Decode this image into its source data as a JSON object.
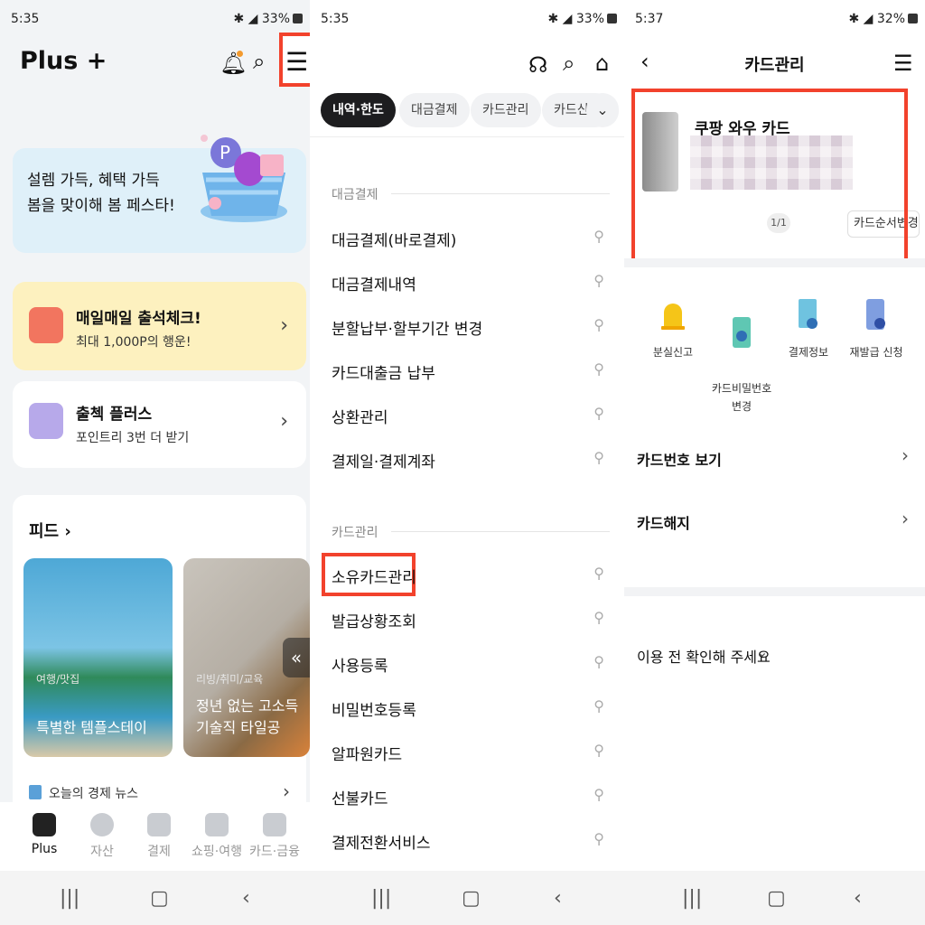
{
  "screen1": {
    "status": {
      "time": "5:35",
      "battery": "33%"
    },
    "logo": "Plus +",
    "banner": {
      "text": "설렘 가득, 혜택 가득\n봄을 맞이해 봄 페스타!"
    },
    "attendance": {
      "title": "매일매일 출석체크!",
      "sub": "최대 1,000P의 행운!"
    },
    "plus": {
      "title": "출첵 플러스",
      "sub": "포인트리 3번 더 받기"
    },
    "feed": {
      "title": "피드 ›",
      "items": [
        {
          "cat": "여행/맛집",
          "caption": "특별한 템플스테이"
        },
        {
          "cat": "리빙/취미/교육",
          "caption": "정년 없는 고소득\n기술직 타일공"
        }
      ],
      "news": "오늘의 경제 뉴스"
    },
    "tabs": [
      "Plus",
      "자산",
      "결제",
      "쇼핑·여행",
      "카드·금융"
    ]
  },
  "screen2": {
    "status": {
      "time": "5:35",
      "battery": "33%"
    },
    "chips": [
      "내역·한도",
      "대금결제",
      "카드관리",
      "카드신청"
    ],
    "sections": [
      {
        "header": "대금결제",
        "items": [
          "대금결제(바로결제)",
          "대금결제내역",
          "분할납부·할부기간 변경",
          "카드대출금 납부",
          "상환관리",
          "결제일·결제계좌"
        ]
      },
      {
        "header": "카드관리",
        "items": [
          "소유카드관리",
          "발급상황조회",
          "사용등록",
          "비밀번호등록",
          "알파원카드",
          "선불카드",
          "결제전환서비스"
        ]
      }
    ]
  },
  "screen3": {
    "status": {
      "time": "5:37",
      "battery": "32%"
    },
    "title": "카드관리",
    "card": {
      "name": "쿠팡 와우 카드",
      "pager": "1/1",
      "order_button": "카드순서변경"
    },
    "actions": [
      {
        "label": "분실신고",
        "icon": "siren-icon"
      },
      {
        "label": "카드비밀번호\n변경",
        "icon": "card-lock-icon"
      },
      {
        "label": "결제정보",
        "icon": "payment-info-icon"
      },
      {
        "label": "재발급 신청",
        "icon": "card-reissue-icon"
      }
    ],
    "rows": [
      "카드번호 보기",
      "카드해지"
    ],
    "notice": "이용 전 확인해 주세요"
  },
  "colors": {
    "highlight": "#f2422c",
    "chip_active": "#1d1d1f",
    "banner_bg": "#dff0f9",
    "attendance_bg": "#fdf1bf"
  }
}
